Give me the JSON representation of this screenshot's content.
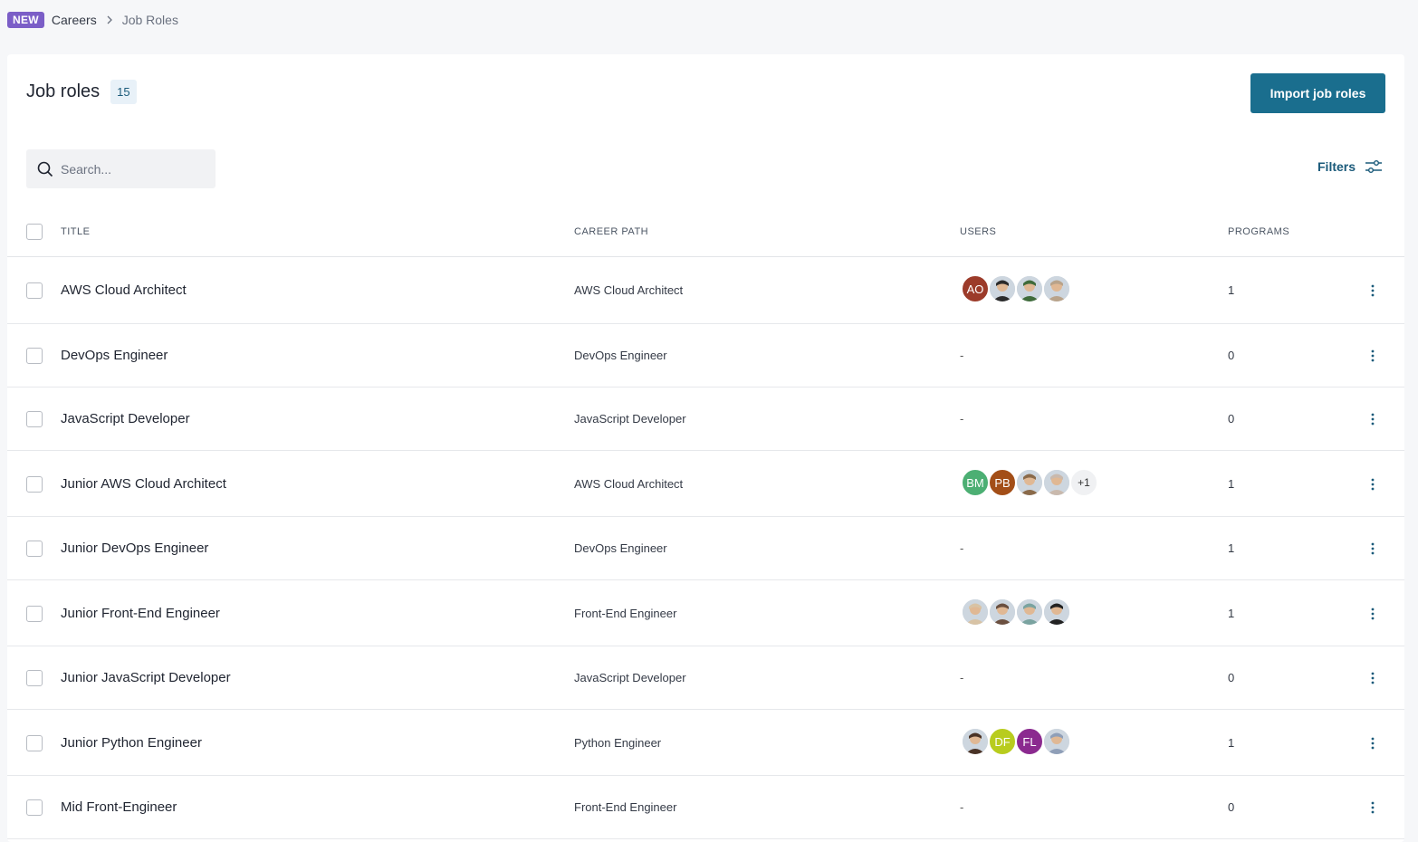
{
  "breadcrumb": {
    "badge": "NEW",
    "items": [
      "Careers",
      "Job Roles"
    ]
  },
  "page": {
    "title": "Job roles",
    "count": "15",
    "import_label": "Import job roles"
  },
  "search": {
    "placeholder": "Search..."
  },
  "filters": {
    "label": "Filters"
  },
  "columns": {
    "title": "TITLE",
    "career_path": "CAREER PATH",
    "users": "USERS",
    "programs": "PROGRAMS"
  },
  "rows": [
    {
      "title": "AWS Cloud Architect",
      "path": "AWS Cloud Architect",
      "users_text": "",
      "programs": "1"
    },
    {
      "title": "DevOps Engineer",
      "path": "DevOps Engineer",
      "users_text": "-",
      "programs": "0"
    },
    {
      "title": "JavaScript Developer",
      "path": "JavaScript Developer",
      "users_text": "-",
      "programs": "0"
    },
    {
      "title": "Junior AWS Cloud Architect",
      "path": "AWS Cloud Architect",
      "users_text": "",
      "programs": "1"
    },
    {
      "title": "Junior DevOps Engineer",
      "path": "DevOps Engineer",
      "users_text": "-",
      "programs": "1"
    },
    {
      "title": "Junior Front-End Engineer",
      "path": "Front-End Engineer",
      "users_text": "",
      "programs": "1"
    },
    {
      "title": "Junior JavaScript Developer",
      "path": "JavaScript Developer",
      "users_text": "-",
      "programs": "0"
    },
    {
      "title": "Junior Python Engineer",
      "path": "Python Engineer",
      "users_text": "",
      "programs": "1"
    },
    {
      "title": "Mid Front-Engineer",
      "path": "Front-End Engineer",
      "users_text": "-",
      "programs": "0"
    }
  ],
  "avatars": {
    "r0": [
      {
        "initials": "AO",
        "color": "#9c3b2a"
      },
      {
        "photo": "#2b2b2b"
      },
      {
        "photo": "#3f6b3a"
      },
      {
        "photo": "#b9a38a"
      }
    ],
    "r3": [
      {
        "initials": "BM",
        "color": "#4caf73"
      },
      {
        "initials": "PB",
        "color": "#a34e17"
      },
      {
        "photo": "#8a6a4a"
      },
      {
        "photo": "#c9b9ad"
      },
      {
        "more": "+1"
      }
    ],
    "r5": [
      {
        "photo": "#d8c3a5"
      },
      {
        "photo": "#6b5040"
      },
      {
        "photo": "#7aa3a0"
      },
      {
        "photo": "#222222"
      }
    ],
    "r7": [
      {
        "photo": "#4a3326"
      },
      {
        "initials": "DF",
        "color": "#b8cc1e"
      },
      {
        "initials": "FL",
        "color": "#8b2a8f"
      },
      {
        "photo": "#8f9fb8"
      }
    ]
  }
}
